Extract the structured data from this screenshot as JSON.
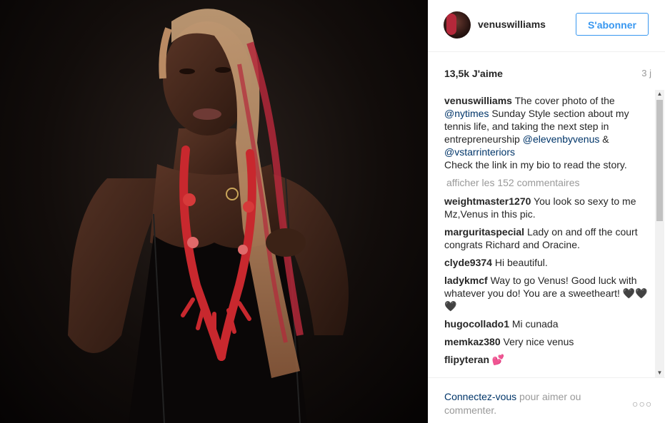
{
  "post": {
    "username": "venuswilliams",
    "follow_label": "S'abonner",
    "likes": "13,5k J'aime",
    "time_ago": "3 j"
  },
  "caption": {
    "username": "venuswilliams",
    "part1": "The cover photo of the ",
    "mention1": "@nytimes",
    "part2": " Sunday Style section about my tennis life, and taking the next step in entrepreneurship ",
    "mention2": "@elevenbyvenus",
    "part3": " & ",
    "mention3": "@vstarrinteriors",
    "part4": "Check the link in my bio to read the story."
  },
  "load_more": "afficher les 152 commentaires",
  "comments": [
    {
      "user": "weightmaster1270",
      "text": "You look so sexy to me Mz,Venus in this pic."
    },
    {
      "user": "marguritaspecial",
      "text": "Lady on and off the court congrats Richard and Oracine."
    },
    {
      "user": "clyde9374",
      "text": "Hi beautiful."
    },
    {
      "user": "ladykmcf",
      "text": "Way to go Venus! Good luck with whatever you do! You are a sweetheart! 🖤🖤🖤"
    },
    {
      "user": "hugocollado1",
      "text": "Mi cunada"
    },
    {
      "user": "memkaz380",
      "text": "Very nice venus"
    },
    {
      "user": "flipyteran",
      "text": "💕"
    }
  ],
  "footer": {
    "login_link": "Connectez-vous",
    "login_rest": " pour aimer ou commenter.",
    "more": "○○○"
  },
  "icons": {
    "scroll_up": "triangle-up",
    "scroll_down": "triangle-down",
    "more_options": "dots-horizontal"
  },
  "colors": {
    "accent": "#3897f0",
    "link": "#003569",
    "muted": "#999999"
  }
}
